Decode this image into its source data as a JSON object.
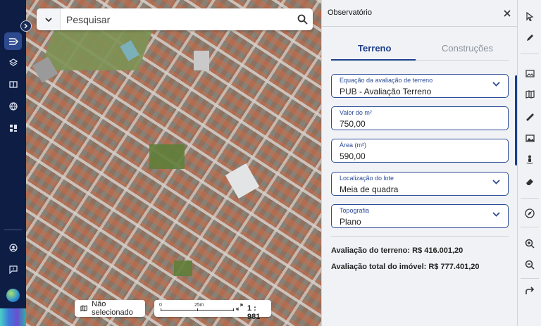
{
  "search": {
    "placeholder": "Pesquisar"
  },
  "nav": {
    "items": [
      {
        "icon": "layers-panel-icon",
        "active": true
      },
      {
        "icon": "stack-icon"
      },
      {
        "icon": "book-icon"
      },
      {
        "icon": "globe-icon"
      },
      {
        "icon": "dashboard-icon"
      }
    ],
    "bottom": [
      {
        "icon": "account-icon"
      },
      {
        "icon": "feedback-icon"
      },
      {
        "icon": "earth-logo-icon"
      }
    ]
  },
  "map": {
    "selection_label": "Não selecionado",
    "scale": {
      "zero": "0",
      "mid": "25m",
      "ratio": "1 : 981"
    }
  },
  "panel": {
    "title": "Observatório",
    "tabs": [
      {
        "label": "Terreno",
        "active": true
      },
      {
        "label": "Construções",
        "active": false
      }
    ],
    "fields": [
      {
        "label": "Equação da avaliação de terreno",
        "value": "PUB - Avaliação Terreno",
        "dropdown": true
      },
      {
        "label": "Valor do m²",
        "value": "750,00",
        "dropdown": false
      },
      {
        "label": "Área (m²)",
        "value": "590,00",
        "dropdown": false
      },
      {
        "label": "Localização do lote",
        "value": "Meia de quadra",
        "dropdown": true
      },
      {
        "label": "Topografia",
        "value": "Plano",
        "dropdown": true
      }
    ],
    "results": {
      "terrain": "Avaliação do terreno: R$ 416.001,20",
      "total": "Avaliação total do imóvel: R$ 777.401,20"
    }
  },
  "toolbar": [
    "pointer-icon",
    "pencil-icon",
    "image-landscape-icon",
    "map-book-icon",
    "ruler-icon",
    "photo-icon",
    "street-view-icon",
    "eraser-icon",
    "compass-icon",
    "zoom-in-icon",
    "zoom-out-icon",
    "share-arrow-icon"
  ],
  "colors": {
    "accent": "#1d3e8a",
    "rail": "#0e1d44"
  }
}
